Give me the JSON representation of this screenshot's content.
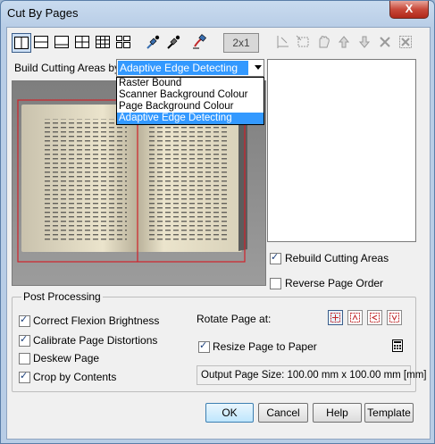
{
  "window": {
    "title": "Cut By Pages",
    "close_label": "X"
  },
  "toolbar": {
    "layout_buttons": [
      "layout-2-vertical",
      "layout-2-horizontal",
      "layout-1-bottom",
      "layout-4-grid",
      "layout-9-grid",
      "layout-mixed"
    ],
    "ratio_label": "2x1"
  },
  "build": {
    "label": "Build Cutting Areas by:",
    "selected": "Adaptive Edge Detecting",
    "options": [
      "Raster Bound",
      "Scanner Background Colour",
      "Page Background Colour",
      "Adaptive Edge Detecting"
    ]
  },
  "right_panel": {
    "rebuild_label": "Rebuild Cutting Areas",
    "rebuild_checked": true,
    "reverse_label": "Reverse Page Order",
    "reverse_checked": false
  },
  "post_processing": {
    "title": "Post Processing",
    "options": [
      {
        "label": "Correct Flexion Brightness",
        "checked": true
      },
      {
        "label": "Calibrate Page Distortions",
        "checked": true
      },
      {
        "label": "Deskew Page",
        "checked": false
      },
      {
        "label": "Crop by Contents",
        "checked": true
      }
    ],
    "rotate_label": "Rotate Page at:",
    "resize_label": "Resize Page to Paper",
    "resize_checked": true,
    "output_size": "Output Page Size: 100.00 mm x 100.00 mm [mm]"
  },
  "buttons": {
    "ok": "OK",
    "cancel": "Cancel",
    "help": "Help",
    "template": "Template"
  },
  "colors": {
    "accent": "#3399ff",
    "cut_line": "#d0222a"
  }
}
